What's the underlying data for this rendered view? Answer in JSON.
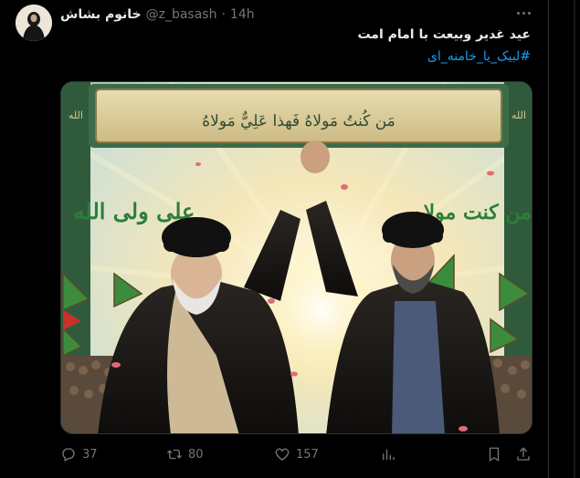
{
  "post": {
    "display_name": "خانوم بشاش",
    "handle": "@z_basash",
    "separator": "·",
    "time": "14h",
    "text": "عید غدیر وبیعت با امام امت",
    "hashtag": "#لبیک_یا_خامنه_ای"
  },
  "media": {
    "banner_text": "مَن كُنتُ مَولاهُ فَهذا عَلِيٌّ مَولاهُ",
    "left_calligraphy": "علی ولی الله",
    "right_calligraphy": "من کنت مولاه",
    "flag_script": "الله"
  },
  "actions": {
    "replies": "37",
    "reposts": "80",
    "likes": "157"
  },
  "icons": [
    "more-icon",
    "reply-icon",
    "repost-icon",
    "like-icon",
    "views-icon",
    "bookmark-icon",
    "share-icon"
  ],
  "colors": {
    "background": "#000000",
    "text": "#e7e9ea",
    "muted": "#71767b",
    "link": "#1d9bf0"
  }
}
